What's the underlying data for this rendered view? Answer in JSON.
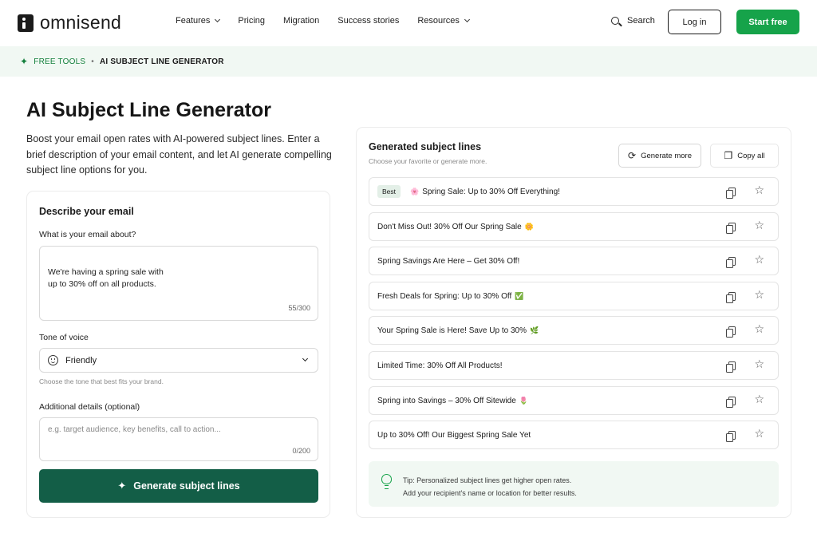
{
  "nav": {
    "logo": "omnisend",
    "links": [
      {
        "label": "Features",
        "dropdown": true
      },
      {
        "label": "Pricing",
        "dropdown": false
      },
      {
        "label": "Migration",
        "dropdown": false
      },
      {
        "label": "Success stories",
        "dropdown": false
      },
      {
        "label": "Resources",
        "dropdown": true
      }
    ],
    "search": "Search",
    "login": "Log in",
    "start": "Start free"
  },
  "breadcrumb": {
    "parent": "FREE TOOLS",
    "separator": "•",
    "current": "AI SUBJECT LINE GENERATOR"
  },
  "hero": {
    "title": "AI Subject Line Generator",
    "description": "Boost your email open rates with AI-powered subject lines. Enter a brief description of your email content, and let AI generate compelling subject line options for you."
  },
  "form": {
    "heading": "Describe your email",
    "about_label": "What is your email about?",
    "about_value": "We're having a spring sale with\nup to 30% off on all products.",
    "about_counter": "55/300",
    "tone_label": "Tone of voice",
    "tone_value": "Friendly",
    "tone_hint": "Choose the tone that best fits your brand.",
    "details_label": "Additional details (optional)",
    "details_placeholder": "e.g. target audience, key benefits, call to action...",
    "details_counter": "0/200",
    "generate_label": "Generate subject lines"
  },
  "results": {
    "title": "Generated subject lines",
    "subtitle": "Choose your favorite or generate more.",
    "generate_more": "Generate more",
    "copy_all": "Copy all",
    "best_badge": "Best",
    "lines": [
      {
        "pre": "🌸",
        "text": "Spring Sale: Up to 30% Off Everything!",
        "post": ""
      },
      {
        "pre": "",
        "text": "Don't Miss Out! 30% Off Our Spring Sale",
        "post": "🌼"
      },
      {
        "pre": "",
        "text": "Spring Savings Are Here – Get 30% Off!",
        "post": ""
      },
      {
        "pre": "",
        "text": "Fresh Deals for Spring: Up to 30% Off",
        "post": "✅"
      },
      {
        "pre": "",
        "text": "Your Spring Sale is Here! Save Up to 30%",
        "post": "🌿"
      },
      {
        "pre": "",
        "text": "Limited Time: 30% Off All Products!",
        "post": ""
      },
      {
        "pre": "",
        "text": "Spring into Savings – 30% Off Sitewide",
        "post": "🌷"
      },
      {
        "pre": "",
        "text": "Up to 30% Off! Our Biggest Spring Sale Yet",
        "post": ""
      }
    ],
    "tip": "Tip: Personalized subject lines get higher open rates.\nAdd your recipient's name or location for better results."
  },
  "colors": {
    "accent_green": "#16a34a",
    "primary_button": "#135e47",
    "tint_bg": "#f1f8f3"
  }
}
